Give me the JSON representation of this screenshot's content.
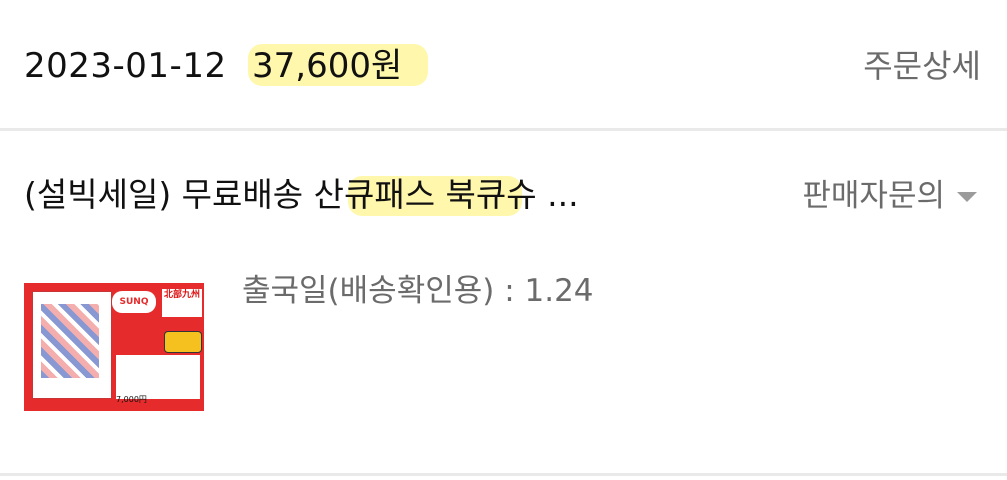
{
  "order": {
    "date": "2023-01-12",
    "amount": "37,600원",
    "detail_link": "주문상세"
  },
  "product": {
    "title": "(설빅세일) 무료배송 산큐패스 북큐슈 ...",
    "seller_inquiry": "판매자문의",
    "thumbnail": {
      "logo_text": "SUNQ",
      "title_text": "北部九州",
      "price_text": "7,000円"
    },
    "ship_label": "출국일(배송확인용) : 1.24"
  },
  "colors": {
    "highlight": "#fff69c",
    "muted_text": "#6b6b6b",
    "divider": "#e9e9e9",
    "thumb_red": "#e52b2b"
  }
}
